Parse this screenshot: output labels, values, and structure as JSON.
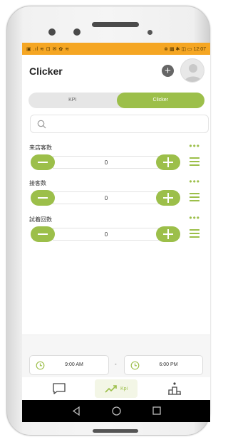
{
  "status_bar": {
    "left_icons": "▣ .ıl ≋ ⊡ ✉ ✿ ≋",
    "right_text": "⊗ ▩ ✱ ◫ ▭ 12:07"
  },
  "header": {
    "title": "Clicker"
  },
  "tabs": [
    {
      "label": "KPI",
      "active": false
    },
    {
      "label": "Clicker",
      "active": true
    }
  ],
  "search": {
    "placeholder": ""
  },
  "counters": [
    {
      "label": "来店客数",
      "value": "0"
    },
    {
      "label": "接客数",
      "value": "0"
    },
    {
      "label": "試着回数",
      "value": "0"
    }
  ],
  "time_range": {
    "start": "9:00 AM",
    "separator": "-",
    "end": "6:00 PM"
  },
  "bottom_nav": {
    "kpi_label": "Kpi"
  },
  "colors": {
    "accent": "#9cbf4a",
    "status_bar": "#f5a623"
  },
  "icons": {
    "add": "plus-circle-icon",
    "avatar": "user-avatar-icon",
    "search": "search-icon",
    "chat": "chat-bubble-icon",
    "kpi": "trending-up-icon",
    "ranking": "ranking-icon"
  }
}
